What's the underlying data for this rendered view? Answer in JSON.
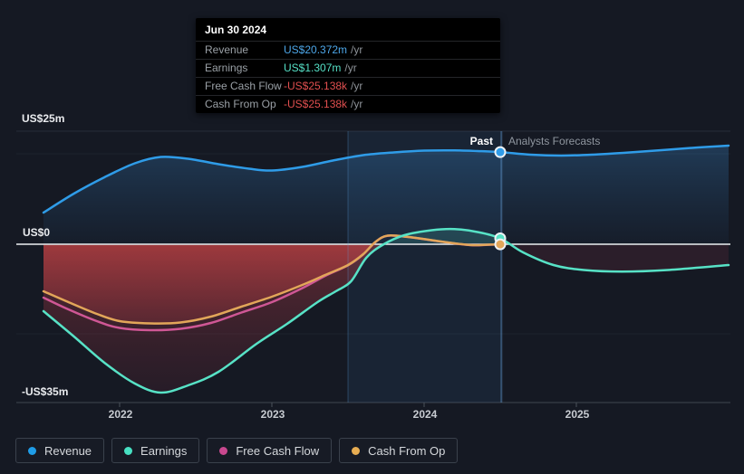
{
  "tooltip": {
    "date": "Jun 30 2024",
    "rows": [
      {
        "label": "Revenue",
        "value": "US$20.372m",
        "suffix": "/yr",
        "color": "#4da6e8"
      },
      {
        "label": "Earnings",
        "value": "US$1.307m",
        "suffix": "/yr",
        "color": "#55e0c6"
      },
      {
        "label": "Free Cash Flow",
        "value": "-US$25.138k",
        "suffix": "/yr",
        "color": "#e14f4f"
      },
      {
        "label": "Cash From Op",
        "value": "-US$25.138k",
        "suffix": "/yr",
        "color": "#e14f4f"
      }
    ]
  },
  "axis": {
    "y_labels": [
      "US$25m",
      "US$0",
      "-US$35m"
    ],
    "x_labels": [
      "2022",
      "2023",
      "2024",
      "2025"
    ]
  },
  "annotations": {
    "past_label": "Past",
    "forecast_label": "Analysts Forecasts"
  },
  "legend": [
    {
      "label": "Revenue",
      "color": "#1f9de8"
    },
    {
      "label": "Earnings",
      "color": "#47e0c2"
    },
    {
      "label": "Free Cash Flow",
      "color": "#c9488f"
    },
    {
      "label": "Cash From Op",
      "color": "#e7ad52"
    }
  ],
  "chart_data": {
    "type": "line",
    "title": "Earnings and Revenue Growth with Analysts Forecasts",
    "units": "US$ millions per year",
    "xlim": [
      2021.5,
      2026.0
    ],
    "ylim": [
      -35,
      25
    ],
    "x_ticks": [
      2022,
      2023,
      2024,
      2025
    ],
    "y_gridlines_labeled": [
      25,
      0,
      -35
    ],
    "y_gridlines_faint": [
      20,
      -20
    ],
    "divider_x": 2024.5,
    "highlight_band": [
      2023.5,
      2024.5
    ],
    "legend_position": "bottom",
    "series": [
      {
        "name": "Revenue",
        "color": "#2f9ce8",
        "points": [
          [
            2021.5,
            7.0
          ],
          [
            2021.7,
            11.2
          ],
          [
            2021.9,
            14.8
          ],
          [
            2022.1,
            17.9
          ],
          [
            2022.27,
            19.3
          ],
          [
            2022.45,
            18.9
          ],
          [
            2022.65,
            17.7
          ],
          [
            2022.85,
            16.7
          ],
          [
            2023.0,
            16.3
          ],
          [
            2023.2,
            17.1
          ],
          [
            2023.4,
            18.5
          ],
          [
            2023.6,
            19.7
          ],
          [
            2023.8,
            20.3
          ],
          [
            2024.0,
            20.7
          ],
          [
            2024.2,
            20.75
          ],
          [
            2024.35,
            20.6
          ],
          [
            2024.5,
            20.372
          ],
          [
            2024.7,
            19.8
          ],
          [
            2024.9,
            19.6
          ],
          [
            2025.1,
            19.8
          ],
          [
            2025.35,
            20.3
          ],
          [
            2025.6,
            20.9
          ],
          [
            2025.8,
            21.4
          ],
          [
            2026.0,
            21.8
          ]
        ]
      },
      {
        "name": "Earnings",
        "color": "#57e2c6",
        "points": [
          [
            2021.5,
            -14.8
          ],
          [
            2021.7,
            -20.4
          ],
          [
            2021.9,
            -26.2
          ],
          [
            2022.1,
            -30.8
          ],
          [
            2022.27,
            -32.8
          ],
          [
            2022.45,
            -31.2
          ],
          [
            2022.65,
            -28.2
          ],
          [
            2022.9,
            -22.0
          ],
          [
            2023.1,
            -17.6
          ],
          [
            2023.3,
            -12.8
          ],
          [
            2023.42,
            -10.4
          ],
          [
            2023.52,
            -8.2
          ],
          [
            2023.62,
            -3.0
          ],
          [
            2023.73,
            -0.1
          ],
          [
            2023.87,
            2.0
          ],
          [
            2024.05,
            3.1
          ],
          [
            2024.2,
            3.35
          ],
          [
            2024.35,
            2.7
          ],
          [
            2024.5,
            1.307
          ],
          [
            2024.65,
            -1.8
          ],
          [
            2024.85,
            -4.6
          ],
          [
            2025.05,
            -5.7
          ],
          [
            2025.3,
            -6.05
          ],
          [
            2025.6,
            -5.7
          ],
          [
            2026.0,
            -4.6
          ]
        ]
      },
      {
        "name": "Free Cash Flow",
        "color": "#cf5795",
        "points": [
          [
            2021.5,
            -11.8
          ],
          [
            2021.65,
            -14.2
          ],
          [
            2021.85,
            -17.0
          ],
          [
            2022.0,
            -18.5
          ],
          [
            2022.2,
            -19.0
          ],
          [
            2022.4,
            -18.7
          ],
          [
            2022.6,
            -17.4
          ],
          [
            2022.8,
            -15.1
          ],
          [
            2023.0,
            -12.8
          ],
          [
            2023.2,
            -9.7
          ],
          [
            2023.35,
            -7.0
          ],
          [
            2023.5,
            -4.65
          ],
          [
            2023.6,
            -2.25
          ],
          [
            2023.68,
            0.48
          ],
          [
            2023.76,
            1.88
          ],
          [
            2023.9,
            1.58
          ],
          [
            2024.05,
            0.88
          ],
          [
            2024.2,
            0.18
          ],
          [
            2024.32,
            -0.22
          ],
          [
            2024.42,
            -0.12
          ],
          [
            2024.5,
            -0.025
          ]
        ]
      },
      {
        "name": "Cash From Op",
        "color": "#e2a659",
        "points": [
          [
            2021.5,
            -10.4
          ],
          [
            2021.65,
            -12.6
          ],
          [
            2021.85,
            -15.4
          ],
          [
            2022.0,
            -17.0
          ],
          [
            2022.2,
            -17.5
          ],
          [
            2022.4,
            -17.3
          ],
          [
            2022.6,
            -16.0
          ],
          [
            2022.8,
            -13.8
          ],
          [
            2023.0,
            -11.6
          ],
          [
            2023.2,
            -9.0
          ],
          [
            2023.35,
            -6.8
          ],
          [
            2023.5,
            -4.6
          ],
          [
            2023.6,
            -2.2
          ],
          [
            2023.68,
            0.5
          ],
          [
            2023.76,
            1.9
          ],
          [
            2023.9,
            1.6
          ],
          [
            2024.05,
            0.9
          ],
          [
            2024.2,
            0.2
          ],
          [
            2024.32,
            -0.2
          ],
          [
            2024.42,
            -0.1
          ],
          [
            2024.5,
            -0.025
          ]
        ]
      }
    ],
    "markers": [
      {
        "series": "Revenue",
        "x": 2024.5,
        "value": 20.372
      },
      {
        "series": "Earnings",
        "x": 2024.5,
        "value": 1.307
      },
      {
        "series": "Cash From Op",
        "x": 2024.5,
        "value": -0.025
      }
    ]
  }
}
